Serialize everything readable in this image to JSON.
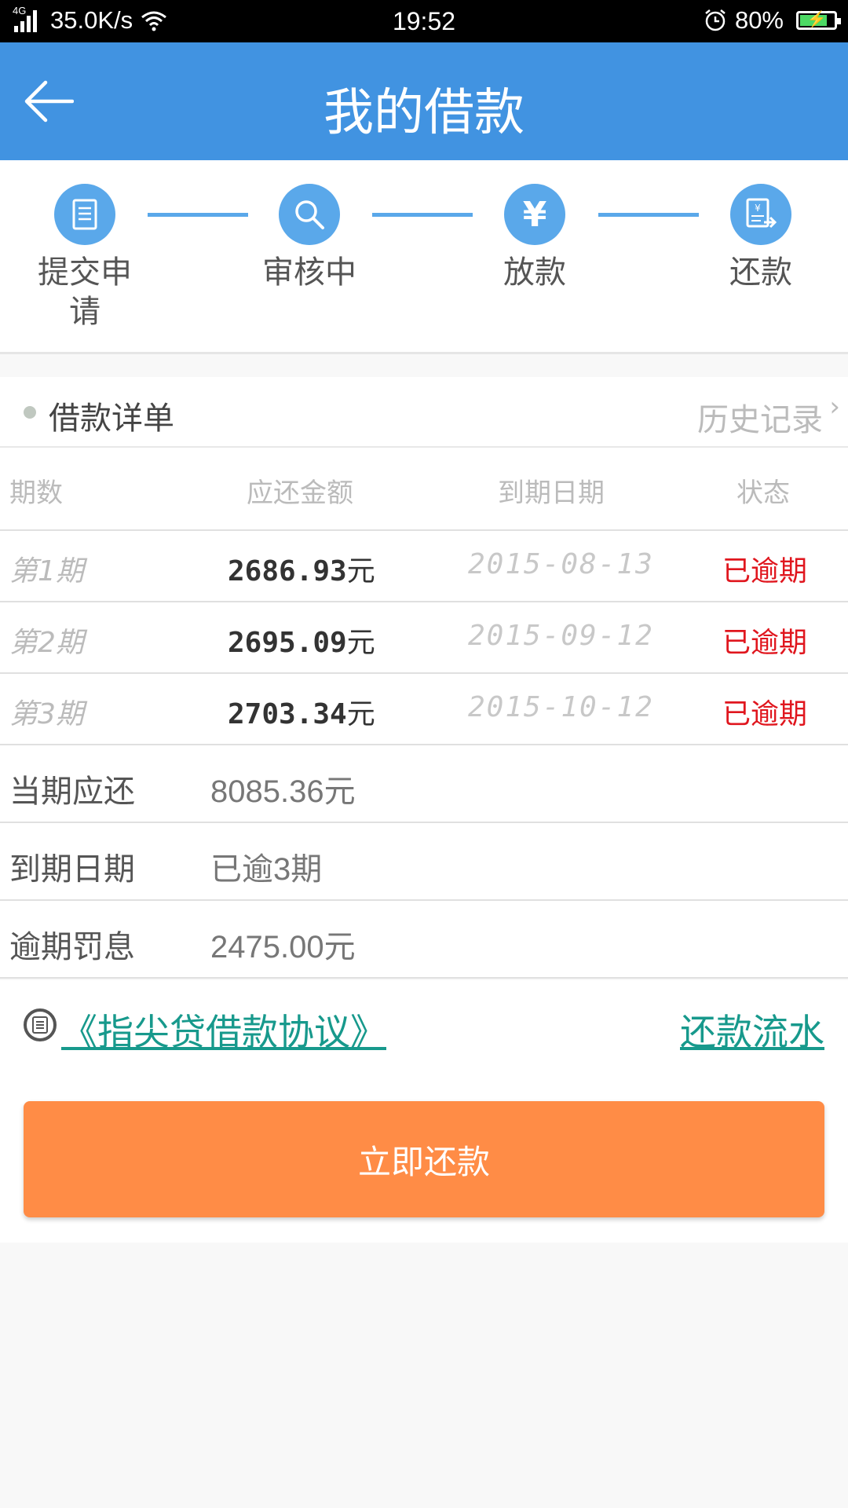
{
  "status_bar": {
    "network": "4G",
    "speed": "35.0K/s",
    "time": "19:52",
    "battery": "80%",
    "battery_level": 0.8
  },
  "header": {
    "title": "我的借款"
  },
  "steps": [
    {
      "label": "提交申请",
      "icon": "document-icon"
    },
    {
      "label": "审核中",
      "icon": "search-icon"
    },
    {
      "label": "放款",
      "icon": "yen-icon"
    },
    {
      "label": "还款",
      "icon": "repay-bill-icon"
    }
  ],
  "section": {
    "title": "借款详单",
    "history_link": "历史记录"
  },
  "table": {
    "headers": [
      "期数",
      "应还金额",
      "到期日期",
      "状态"
    ],
    "rows": [
      {
        "period": "第1期",
        "amount": "2686.93",
        "unit": "元",
        "date": "2015-08-13",
        "status": "已逾期"
      },
      {
        "period": "第2期",
        "amount": "2695.09",
        "unit": "元",
        "date": "2015-09-12",
        "status": "已逾期"
      },
      {
        "period": "第3期",
        "amount": "2703.34",
        "unit": "元",
        "date": "2015-10-12",
        "status": "已逾期"
      }
    ]
  },
  "summary": [
    {
      "label": "当期应还",
      "value": "8085.36元"
    },
    {
      "label": "到期日期",
      "value": "已逾3期"
    },
    {
      "label": "逾期罚息",
      "value": "2475.00元"
    }
  ],
  "links": {
    "agreement": "《指尖贷借款协议》",
    "repayment_flow": "还款流水"
  },
  "actions": {
    "pay_now": "立即还款"
  },
  "colors": {
    "header": "#4193e1",
    "step_icon": "#5aa8ea",
    "overdue": "#e0161e",
    "link": "#17998c",
    "button": "#ff8c46"
  }
}
